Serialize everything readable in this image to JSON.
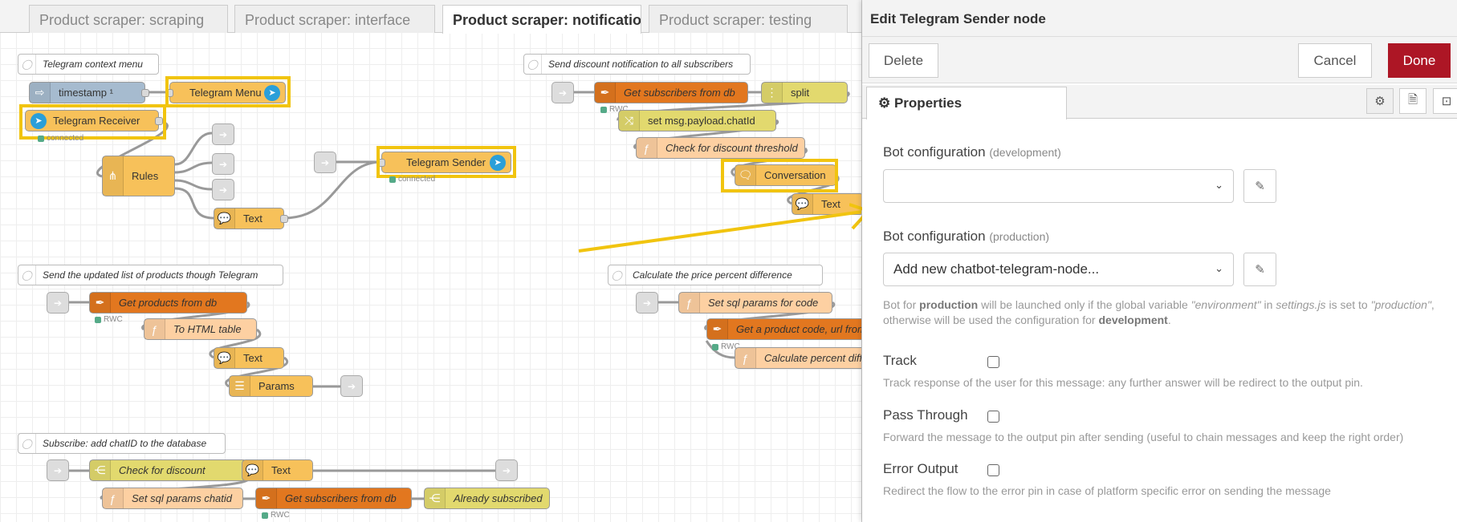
{
  "tabs": [
    {
      "label": "Product scraper: scraping"
    },
    {
      "label": "Product scraper: interface"
    },
    {
      "label": "Product scraper: notifications",
      "active": true
    },
    {
      "label": "Product scraper: testing"
    }
  ],
  "flows": {
    "comments": [
      "Telegram context menu",
      "Send discount notification to all subscribers",
      "Send the updated list of products though Telegram",
      "Calculate the price percent difference",
      "Subscribe: add chatID to the database"
    ],
    "nodes": {
      "timestamp": "timestamp ¹",
      "telegram_menu": "Telegram Menu",
      "telegram_receiver": "Telegram Receiver",
      "rules": "Rules",
      "text1": "Text",
      "telegram_sender": "Telegram Sender",
      "get_subscribers": "Get subscribers from db",
      "split": "split",
      "set_chatid": "set msg.payload.chatId",
      "check_threshold": "Check for discount threshold",
      "conversation": "Conversation",
      "text2": "Text",
      "get_products": "Get products from db",
      "to_html": "To HTML table",
      "text3": "Text",
      "params": "Params",
      "set_sql_code": "Set sql params for code",
      "get_product_code": "Get a product code, url from",
      "calc_percent": "Calculate percent diff",
      "check_discount": "Check for discount",
      "text4": "Text",
      "set_sql_chatid": "Set sql params chatid",
      "get_subscribers2": "Get subscribers from db",
      "already_subscribed": "Already subscribed"
    },
    "status": {
      "connected": "connected",
      "rwc": "RWC"
    },
    "colors": {
      "highlight": "#f1c40f",
      "sqlite": "#e2771f",
      "function": "#fdd0a2",
      "telegram": "#f7c15a",
      "switch": "#e2d96e",
      "inject": "#a6bbcf"
    }
  },
  "panel": {
    "title": "Edit Telegram Sender node",
    "delete": "Delete",
    "cancel": "Cancel",
    "done": "Done",
    "tab": "Properties",
    "bot_dev_label": "Bot configuration",
    "bot_dev_hint": "(development)",
    "bot_dev_value": "",
    "bot_prod_label": "Bot configuration",
    "bot_prod_hint": "(production)",
    "bot_prod_value": "Add new chatbot-telegram-node...",
    "help1": {
      "a": "Bot for ",
      "b": "production",
      "c": " will be launched only if the global variable ",
      "d": "\"environment\"",
      "e": " in ",
      "f": "settings.js",
      "g": " is set to ",
      "h": "\"production\"",
      "i": ", otherwise will be used the configuration for ",
      "j": "development",
      "k": "."
    },
    "track": {
      "label": "Track",
      "checked": false,
      "help": "Track response of the user for this message: any further answer will be redirect to the output pin."
    },
    "pass": {
      "label": "Pass Through",
      "checked": false,
      "help": "Forward the message to the output pin after sending (useful to chain messages and keep the right order)"
    },
    "error": {
      "label": "Error Output",
      "checked": false,
      "help": "Redirect the flow to the error pin in case of platform specific error on sending the message"
    }
  }
}
